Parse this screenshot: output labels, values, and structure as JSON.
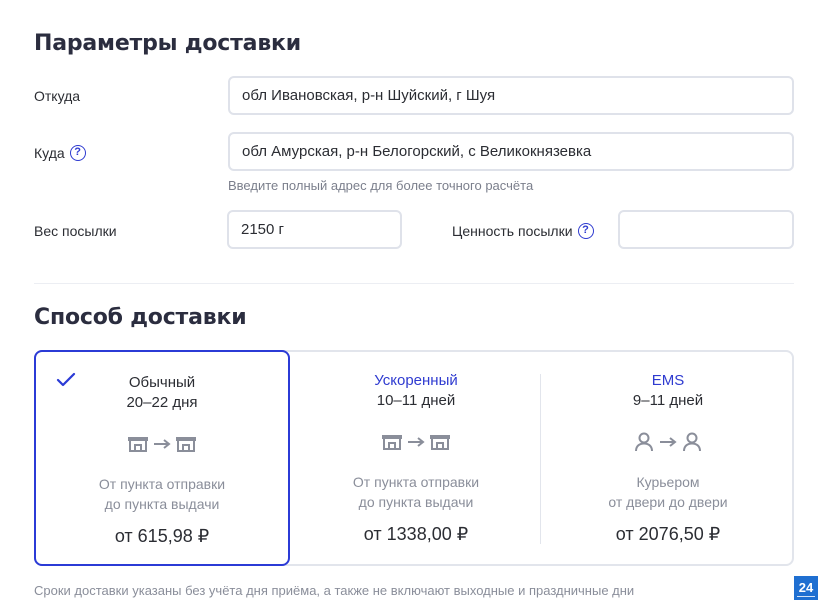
{
  "params": {
    "title": "Параметры доставки",
    "from_label": "Откуда",
    "from_value": "обл Ивановская, р-н Шуйский, г Шуя",
    "to_label": "Куда",
    "to_value": "обл Амурская, р-н Белогорский, с Великокнязевка",
    "address_hint": "Введите полный адрес для более точного расчёта",
    "weight_label": "Вес посылки",
    "weight_value": "2150 г",
    "value_label": "Ценность посылки",
    "value_value": "",
    "help_glyph": "?"
  },
  "delivery": {
    "title": "Способ доставки",
    "options": [
      {
        "name": "Обычный",
        "days": "20–22 дня",
        "icon": "post-office-icon",
        "desc1": "От пункта отправки",
        "desc2": "до пункта выдачи",
        "price": "от 615,98 ₽",
        "selected": true
      },
      {
        "name": "Ускоренный",
        "days": "10–11 дней",
        "icon": "post-office-icon",
        "desc1": "От пункта отправки",
        "desc2": "до пункта выдачи",
        "price": "от 1338,00 ₽",
        "selected": false
      },
      {
        "name": "EMS",
        "days": "9–11 дней",
        "icon": "person-icon",
        "desc1": "Курьером",
        "desc2": "от двери до двери",
        "price": "от 2076,50 ₽",
        "selected": false
      }
    ],
    "footnote": "Сроки доставки указаны без учёта дня приёма, а также не включают выходные и праздничные дни"
  },
  "badge": "24",
  "colors": {
    "accent": "#2b3bd6",
    "link": "#2f3bd0",
    "muted": "#8a8e9a",
    "border": "#dfe2ea"
  }
}
